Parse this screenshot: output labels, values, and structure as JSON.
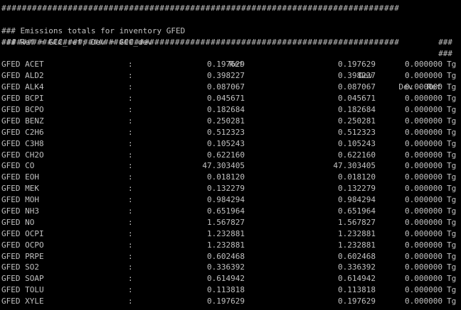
{
  "terminal": {
    "hash_line": "##############################################################################",
    "title_left": "### Emissions totals for inventory GFED",
    "title_right": "###",
    "subtitle_left": "### Ref = GCC_ref; Dev = GCC_dev",
    "subtitle_right": "###",
    "columns": {
      "ref": "Ref",
      "dev": "Dev",
      "diff": "Dev - Ref"
    },
    "separator": ":",
    "unit": "Tg",
    "rows": [
      {
        "name": "GFED ACET",
        "ref": "0.197629",
        "dev": "0.197629",
        "diff": "0.000000"
      },
      {
        "name": "GFED ALD2",
        "ref": "0.398227",
        "dev": "0.398227",
        "diff": "0.000000"
      },
      {
        "name": "GFED ALK4",
        "ref": "0.087067",
        "dev": "0.087067",
        "diff": "0.000000"
      },
      {
        "name": "GFED BCPI",
        "ref": "0.045671",
        "dev": "0.045671",
        "diff": "0.000000"
      },
      {
        "name": "GFED BCPO",
        "ref": "0.182684",
        "dev": "0.182684",
        "diff": "0.000000"
      },
      {
        "name": "GFED BENZ",
        "ref": "0.250281",
        "dev": "0.250281",
        "diff": "0.000000"
      },
      {
        "name": "GFED C2H6",
        "ref": "0.512323",
        "dev": "0.512323",
        "diff": "0.000000"
      },
      {
        "name": "GFED C3H8",
        "ref": "0.105243",
        "dev": "0.105243",
        "diff": "0.000000"
      },
      {
        "name": "GFED CH2O",
        "ref": "0.622160",
        "dev": "0.622160",
        "diff": "0.000000"
      },
      {
        "name": "GFED CO",
        "ref": "47.303405",
        "dev": "47.303405",
        "diff": "0.000000"
      },
      {
        "name": "GFED EOH",
        "ref": "0.018120",
        "dev": "0.018120",
        "diff": "0.000000"
      },
      {
        "name": "GFED MEK",
        "ref": "0.132279",
        "dev": "0.132279",
        "diff": "0.000000"
      },
      {
        "name": "GFED MOH",
        "ref": "0.984294",
        "dev": "0.984294",
        "diff": "0.000000"
      },
      {
        "name": "GFED NH3",
        "ref": "0.651964",
        "dev": "0.651964",
        "diff": "0.000000"
      },
      {
        "name": "GFED NO",
        "ref": "1.567827",
        "dev": "1.567827",
        "diff": "0.000000"
      },
      {
        "name": "GFED OCPI",
        "ref": "1.232881",
        "dev": "1.232881",
        "diff": "0.000000"
      },
      {
        "name": "GFED OCPO",
        "ref": "1.232881",
        "dev": "1.232881",
        "diff": "0.000000"
      },
      {
        "name": "GFED PRPE",
        "ref": "0.602468",
        "dev": "0.602468",
        "diff": "0.000000"
      },
      {
        "name": "GFED SO2",
        "ref": "0.336392",
        "dev": "0.336392",
        "diff": "0.000000"
      },
      {
        "name": "GFED SOAP",
        "ref": "0.614942",
        "dev": "0.614942",
        "diff": "0.000000"
      },
      {
        "name": "GFED TOLU",
        "ref": "0.113818",
        "dev": "0.113818",
        "diff": "0.000000"
      },
      {
        "name": "GFED XYLE",
        "ref": "0.197629",
        "dev": "0.197629",
        "diff": "0.000000"
      }
    ],
    "colors": {
      "background": "#000000",
      "foreground": "#c0c0c0"
    }
  }
}
